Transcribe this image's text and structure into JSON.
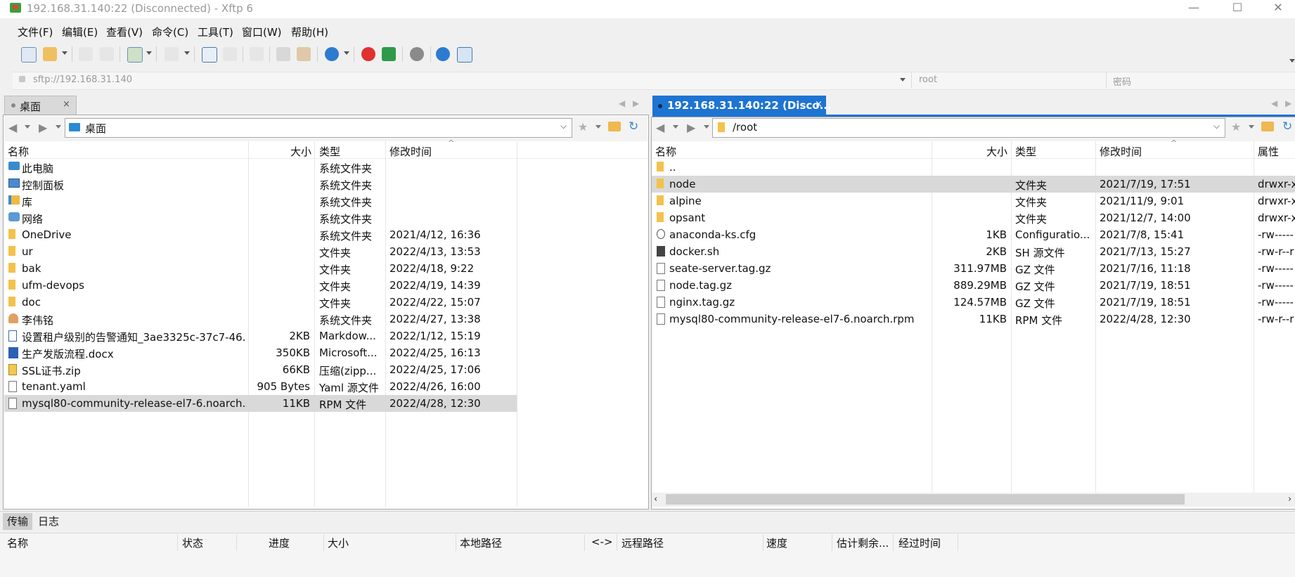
{
  "window": {
    "title": "192.168.31.140:22 (Disconnected) - Xftp 6",
    "minimize": "—",
    "maximize": "☐",
    "close": "✕"
  },
  "menu": [
    "文件(F)",
    "编辑(E)",
    "查看(V)",
    "命令(C)",
    "工具(T)",
    "窗口(W)",
    "帮助(H)"
  ],
  "address": {
    "url": "sftp://192.168.31.140",
    "user_placeholder": "root",
    "password_placeholder": "密码"
  },
  "left": {
    "tab_label": "桌面",
    "path": "桌面",
    "headers": {
      "name": "名称",
      "size": "大小",
      "type": "类型",
      "modified": "修改时间"
    },
    "rows": [
      {
        "icon": "computer",
        "name": "此电脑",
        "size": "",
        "type": "系统文件夹",
        "modified": ""
      },
      {
        "icon": "control-panel",
        "name": "控制面板",
        "size": "",
        "type": "系统文件夹",
        "modified": ""
      },
      {
        "icon": "library",
        "name": "库",
        "size": "",
        "type": "系统文件夹",
        "modified": ""
      },
      {
        "icon": "network",
        "name": "网络",
        "size": "",
        "type": "系统文件夹",
        "modified": ""
      },
      {
        "icon": "folder",
        "name": "OneDrive",
        "size": "",
        "type": "系统文件夹",
        "modified": "2021/4/12, 16:36"
      },
      {
        "icon": "folder",
        "name": "ur",
        "size": "",
        "type": "文件夹",
        "modified": "2022/4/13, 13:53"
      },
      {
        "icon": "folder",
        "name": "bak",
        "size": "",
        "type": "文件夹",
        "modified": "2022/4/18, 9:22"
      },
      {
        "icon": "folder",
        "name": "ufm-devops",
        "size": "",
        "type": "文件夹",
        "modified": "2022/4/19, 14:39"
      },
      {
        "icon": "folder",
        "name": "doc",
        "size": "",
        "type": "文件夹",
        "modified": "2022/4/22, 15:07"
      },
      {
        "icon": "user",
        "name": "李伟铭",
        "size": "",
        "type": "系统文件夹",
        "modified": "2022/4/27, 13:38"
      },
      {
        "icon": "markdown",
        "name": "设置租户级别的告警通知_3ae3325c-37c7-46...",
        "size": "2KB",
        "type": "Markdow...",
        "modified": "2022/1/12, 15:19"
      },
      {
        "icon": "word",
        "name": "生产发版流程.docx",
        "size": "350KB",
        "type": "Microsoft...",
        "modified": "2022/4/25, 16:13"
      },
      {
        "icon": "zip",
        "name": "SSL证书.zip",
        "size": "66KB",
        "type": "压缩(zipp...",
        "modified": "2022/4/25, 17:06"
      },
      {
        "icon": "yaml",
        "name": "tenant.yaml",
        "size": "905 Bytes",
        "type": "Yaml 源文件",
        "modified": "2022/4/26, 16:00"
      },
      {
        "icon": "file",
        "name": "mysql80-community-release-el7-6.noarch....",
        "size": "11KB",
        "type": "RPM 文件",
        "modified": "2022/4/28, 12:30",
        "selected": true
      }
    ]
  },
  "right": {
    "tab_label": "192.168.31.140:22 (Disco...",
    "path": "/root",
    "headers": {
      "name": "名称",
      "size": "大小",
      "type": "类型",
      "modified": "修改时间",
      "attr": "属性"
    },
    "rows": [
      {
        "icon": "folder",
        "name": "..",
        "size": "",
        "type": "",
        "modified": "",
        "attr": ""
      },
      {
        "icon": "folder",
        "name": "node",
        "size": "",
        "type": "文件夹",
        "modified": "2021/7/19, 17:51",
        "attr": "drwxr-x",
        "selected": true
      },
      {
        "icon": "folder",
        "name": "alpine",
        "size": "",
        "type": "文件夹",
        "modified": "2021/11/9, 9:01",
        "attr": "drwxr-x"
      },
      {
        "icon": "folder",
        "name": "opsant",
        "size": "",
        "type": "文件夹",
        "modified": "2021/12/7, 14:00",
        "attr": "drwxr-x"
      },
      {
        "icon": "cfg",
        "name": "anaconda-ks.cfg",
        "size": "1KB",
        "type": "Configuratio...",
        "modified": "2021/7/8, 15:41",
        "attr": "-rw-----"
      },
      {
        "icon": "sh",
        "name": "docker.sh",
        "size": "2KB",
        "type": "SH 源文件",
        "modified": "2021/7/13, 15:27",
        "attr": "-rw-r--r"
      },
      {
        "icon": "file",
        "name": "seate-server.tag.gz",
        "size": "311.97MB",
        "type": "GZ 文件",
        "modified": "2021/7/16, 11:18",
        "attr": "-rw-----"
      },
      {
        "icon": "file",
        "name": "node.tag.gz",
        "size": "889.29MB",
        "type": "GZ 文件",
        "modified": "2021/7/19, 18:51",
        "attr": "-rw-----"
      },
      {
        "icon": "file",
        "name": "nginx.tag.gz",
        "size": "124.57MB",
        "type": "GZ 文件",
        "modified": "2021/7/19, 18:51",
        "attr": "-rw-----"
      },
      {
        "icon": "file",
        "name": "mysql80-community-release-el7-6.noarch.rpm",
        "size": "11KB",
        "type": "RPM 文件",
        "modified": "2022/4/28, 12:30",
        "attr": "-rw-r--r"
      }
    ]
  },
  "transfer": {
    "tabs": [
      "传输",
      "日志"
    ],
    "headers": [
      "名称",
      "状态",
      "进度",
      "大小",
      "本地路径",
      "<->",
      "远程路径",
      "速度",
      "估计剩余...",
      "经过时间"
    ]
  },
  "colors": {
    "accent": "#1e74d2",
    "selected_row": "#d9d9d9",
    "folder": "#f3c24a"
  }
}
